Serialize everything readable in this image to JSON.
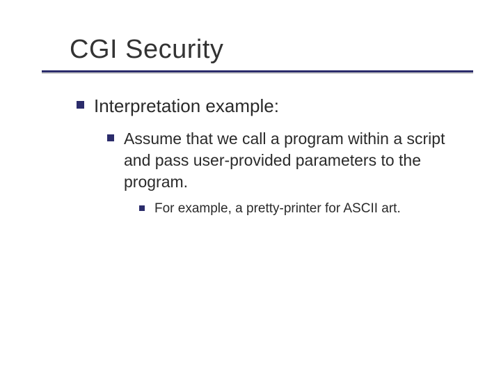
{
  "title": "CGI Security",
  "level1": {
    "text": "Interpretation example:"
  },
  "level2": {
    "text": "Assume that we call a program within a script and pass user-provided parameters to the program."
  },
  "level3": {
    "text": "For example, a pretty-printer for ASCII art."
  }
}
